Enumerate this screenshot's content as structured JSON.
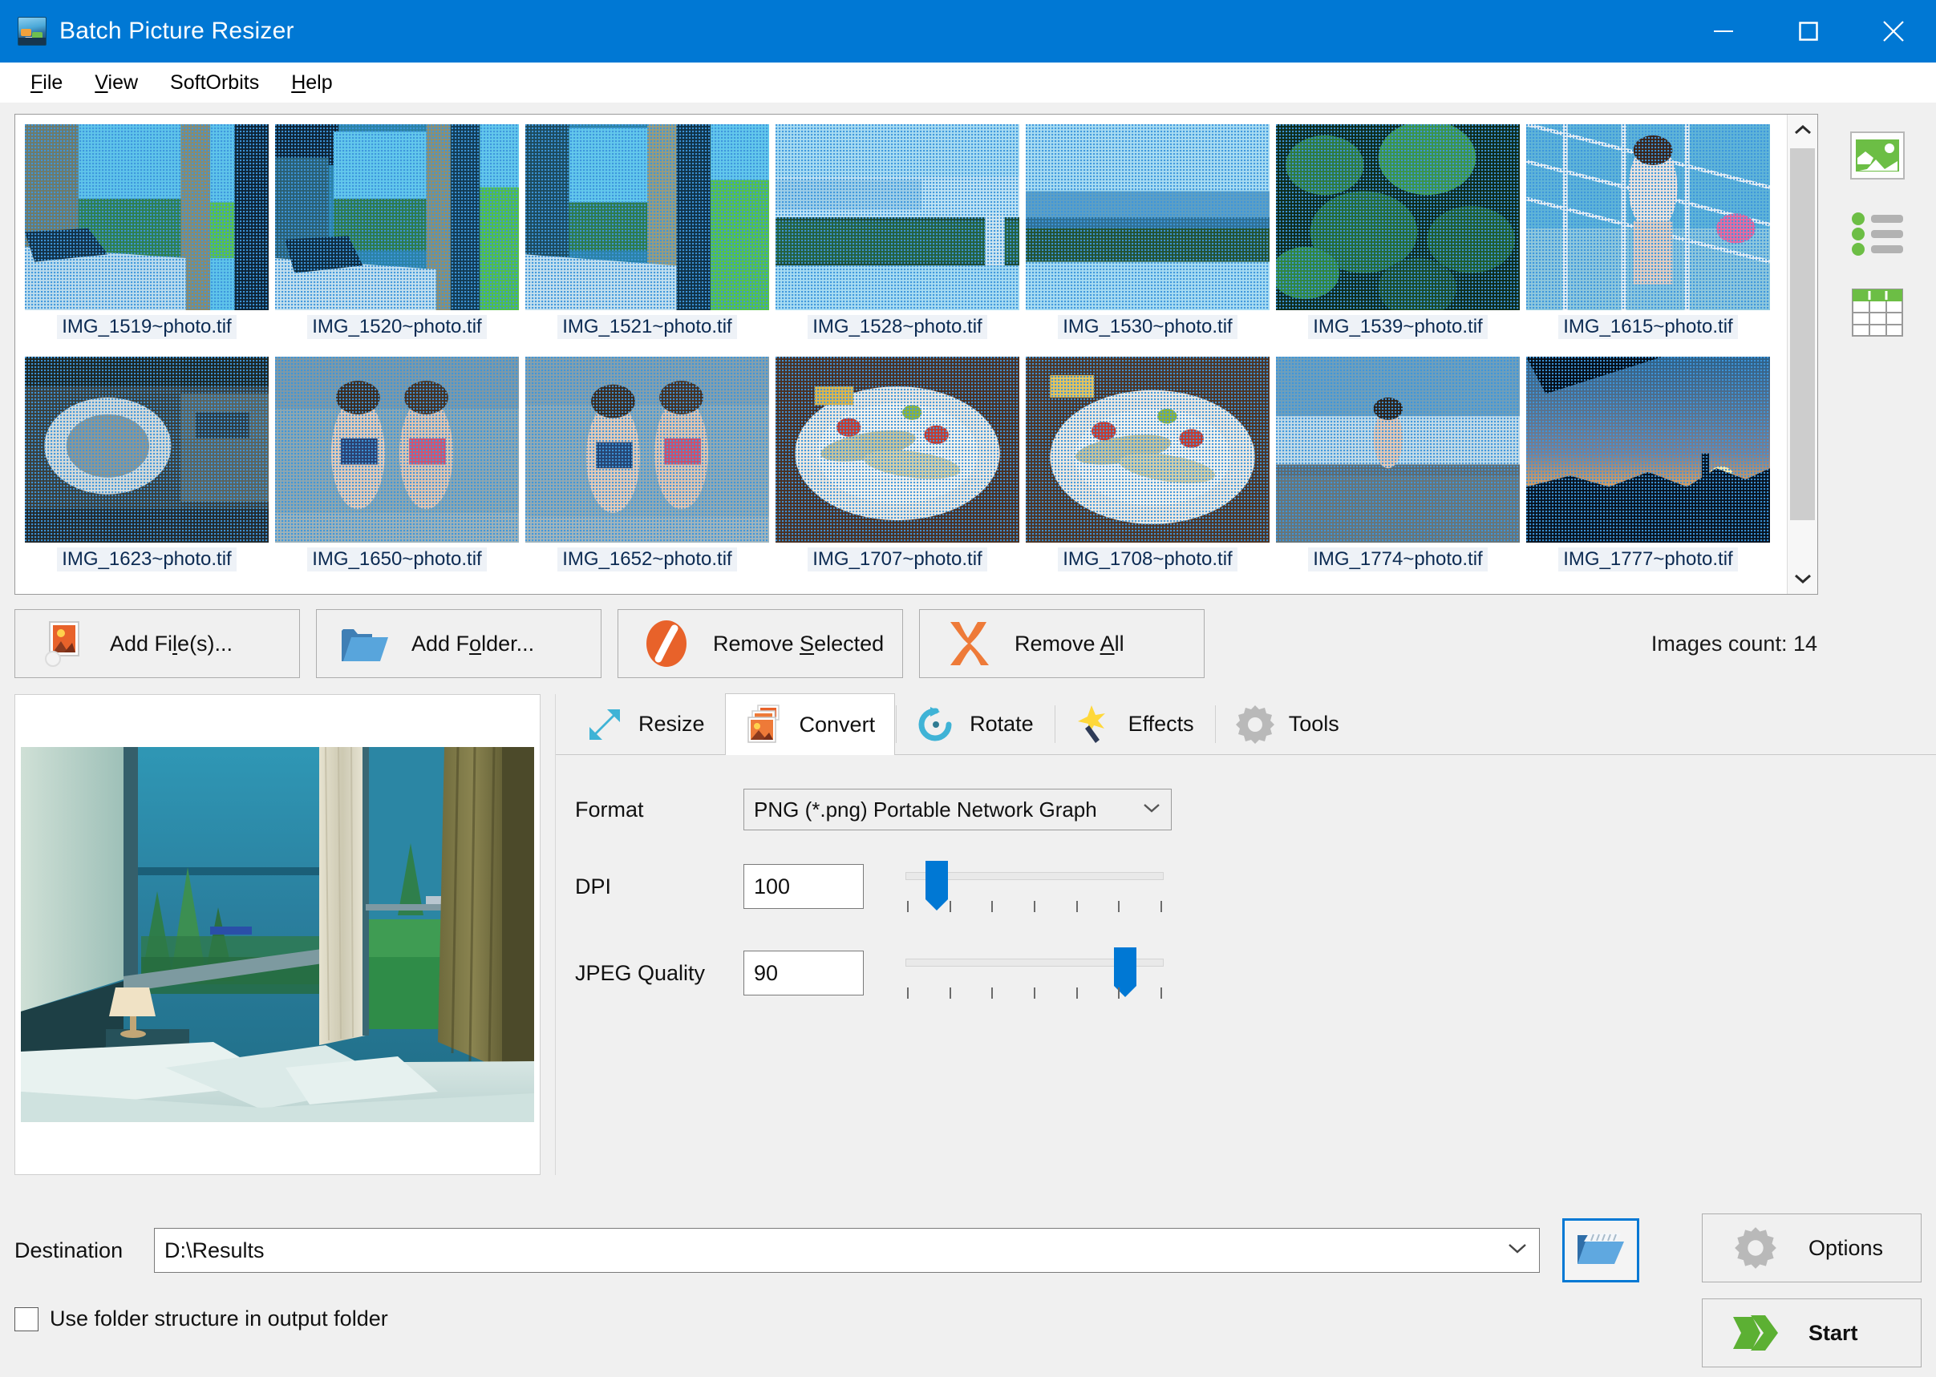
{
  "window": {
    "title": "Batch Picture Resizer",
    "app_icon": "picture-stack-icon",
    "minimize": "minimize-icon",
    "maximize": "maximize-icon",
    "close": "close-icon",
    "titlebar_color": "#0078d4"
  },
  "menu": [
    {
      "label": "File",
      "accel": "F"
    },
    {
      "label": "View",
      "accel": "V"
    },
    {
      "label": "SoftOrbits",
      "accel": ""
    },
    {
      "label": "Help",
      "accel": "H"
    }
  ],
  "thumbnails": [
    {
      "file": "IMG_1519~photo.tif",
      "scene": "room-window-1"
    },
    {
      "file": "IMG_1520~photo.tif",
      "scene": "room-window-2"
    },
    {
      "file": "IMG_1521~photo.tif",
      "scene": "room-window-3"
    },
    {
      "file": "IMG_1528~photo.tif",
      "scene": "panorama-sky-trees"
    },
    {
      "file": "IMG_1530~photo.tif",
      "scene": "panorama-sea-trees"
    },
    {
      "file": "IMG_1539~photo.tif",
      "scene": "foliage-dark"
    },
    {
      "file": "IMG_1615~photo.tif",
      "scene": "girl-net-beach"
    },
    {
      "file": "IMG_1623~photo.tif",
      "scene": "machinery-closeup"
    },
    {
      "file": "IMG_1650~photo.tif",
      "scene": "kids-on-beach-1"
    },
    {
      "file": "IMG_1652~photo.tif",
      "scene": "kids-on-beach-2"
    },
    {
      "file": "IMG_1707~photo.tif",
      "scene": "plate-of-food-1"
    },
    {
      "file": "IMG_1708~photo.tif",
      "scene": "plate-of-food-2"
    },
    {
      "file": "IMG_1774~photo.tif",
      "scene": "child-sea-pebbles"
    },
    {
      "file": "IMG_1777~photo.tif",
      "scene": "sunset-silhouette"
    }
  ],
  "side_toolbar": [
    {
      "name": "thumbnail-view-icon",
      "label": "Thumbnails view"
    },
    {
      "name": "list-view-icon",
      "label": "List view"
    },
    {
      "name": "details-view-icon",
      "label": "Details view"
    }
  ],
  "scrollbar": {
    "up": "chevron-up-icon",
    "down": "chevron-down-icon"
  },
  "actions": [
    {
      "label": "Add File(s)...",
      "accel": "l",
      "icon": "add-image-icon"
    },
    {
      "label": "Add Folder...",
      "accel": "o",
      "icon": "add-folder-icon"
    },
    {
      "label": "Remove Selected",
      "accel": "S",
      "icon": "no-entry-icon"
    },
    {
      "label": "Remove All",
      "accel": "A",
      "icon": "red-cross-icon"
    }
  ],
  "images_count_label": "Images count: 14",
  "preview": {
    "alt": "hotel room bed with sea view through window"
  },
  "tabs": [
    {
      "label": "Resize",
      "icon": "resize-arrow-icon",
      "active": false
    },
    {
      "label": "Convert",
      "icon": "convert-images-icon",
      "active": true
    },
    {
      "label": "Rotate",
      "icon": "rotate-arrow-icon",
      "active": false
    },
    {
      "label": "Effects",
      "icon": "magic-wand-icon",
      "active": false
    },
    {
      "label": "Tools",
      "icon": "gear-icon",
      "active": false
    }
  ],
  "convert": {
    "format_label": "Format",
    "format_value": "PNG (*.png) Portable Network Graph",
    "dropdown_icon": "chevron-down-icon",
    "dpi_label": "DPI",
    "dpi_value": "100",
    "dpi_slider_percent": 12,
    "jpeg_label": "JPEG Quality",
    "jpeg_value": "90",
    "jpeg_slider_percent": 85,
    "tick_count": 7
  },
  "bottom": {
    "destination_label": "Destination",
    "destination_value": "D:\\Results",
    "destination_dropdown_icon": "chevron-down-icon",
    "browse_icon": "open-folder-icon",
    "checkbox_label": "Use folder structure in output folder",
    "checkbox_checked": false,
    "options_label": "Options",
    "options_icon": "gear-icon",
    "start_label": "Start",
    "start_icon": "green-arrow-icon"
  },
  "colors": {
    "accent": "#0078d4",
    "start_green": "#5cb033",
    "remove_orange": "#e8622a",
    "remove_red": "#ed7d3a",
    "view_green": "#6cbe45"
  }
}
